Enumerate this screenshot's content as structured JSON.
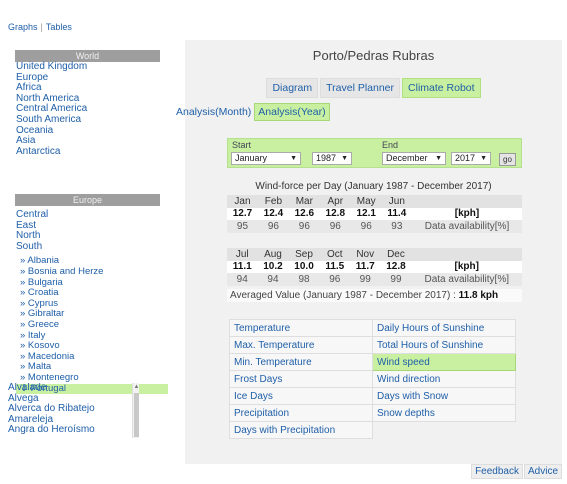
{
  "topnav": {
    "graphs": "Graphs",
    "separator": "|",
    "tables": "Tables"
  },
  "sidebar": {
    "world_header": "World",
    "world_items": [
      "United Kingdom",
      "Europe",
      "Africa",
      "North America",
      "Central America",
      "South America",
      "Oceania",
      "Asia",
      "Antarctica"
    ],
    "europe_header": "Europe",
    "europe_items": [
      "Central",
      "East",
      "North",
      "South"
    ],
    "country_items": [
      "» Albania",
      "» Bosnia and Herze",
      "» Bulgaria",
      "» Croatia",
      "» Cyprus",
      "» Gibraltar",
      "» Greece",
      "» Italy",
      "» Kosovo",
      "» Macedonia",
      "» Malta",
      "» Montenegro",
      "⇓ Portugal"
    ],
    "city_items": [
      "Alvalade",
      "Alvega",
      "Alverca do Ribatejo",
      "Amareleja",
      "Angra do Heroísmo"
    ]
  },
  "main": {
    "title": "Porto/Pedras Rubras",
    "tabs": [
      "Diagram",
      "Travel Planner",
      "Climate Robot"
    ],
    "subtabs": [
      "Analysis(Month)",
      "Analysis(Year)"
    ],
    "selector": {
      "start_label": "Start",
      "end_label": "End",
      "start_month": "January",
      "start_year": "1987",
      "end_month": "December",
      "end_year": "2017",
      "go_label": "go"
    },
    "chart_title": "Wind-force per Day (January 1987 - December 2017)",
    "table1": {
      "months": [
        "Jan",
        "Feb",
        "Mar",
        "Apr",
        "May",
        "Jun"
      ],
      "values": [
        "12.7",
        "12.4",
        "12.6",
        "12.8",
        "12.1",
        "11.4"
      ],
      "avail": [
        "95",
        "96",
        "96",
        "96",
        "96",
        "93"
      ],
      "unit": "[kph]",
      "avail_label": "Data availability[%]"
    },
    "table2": {
      "months": [
        "Jul",
        "Aug",
        "Sep",
        "Oct",
        "Nov",
        "Dec"
      ],
      "values": [
        "11.1",
        "10.2",
        "10.0",
        "11.5",
        "11.7",
        "12.8"
      ],
      "avail": [
        "94",
        "94",
        "98",
        "96",
        "99",
        "99"
      ],
      "unit": "[kph]",
      "avail_label": "Data availability[%]"
    },
    "avg_text": "Averaged Value (January 1987 - December 2017) :",
    "avg_value": "11.8 kph",
    "params_left": [
      "Temperature",
      "Max. Temperature",
      "Min. Temperature",
      "Frost Days",
      "Ice Days",
      "Precipitation",
      "Days with Precipitation"
    ],
    "params_right": [
      "Daily Hours of Sunshine",
      "Total Hours of Sunshine",
      "Wind speed",
      "Wind direction",
      "Days with Snow",
      "Snow depths",
      ""
    ],
    "active_param": "Wind speed"
  },
  "footer": {
    "feedback": "Feedback",
    "advice": "Advice"
  },
  "colors": {
    "accent": "#c8f0a0",
    "link": "#1f5fa8",
    "header_gray": "#9e9e9e"
  }
}
